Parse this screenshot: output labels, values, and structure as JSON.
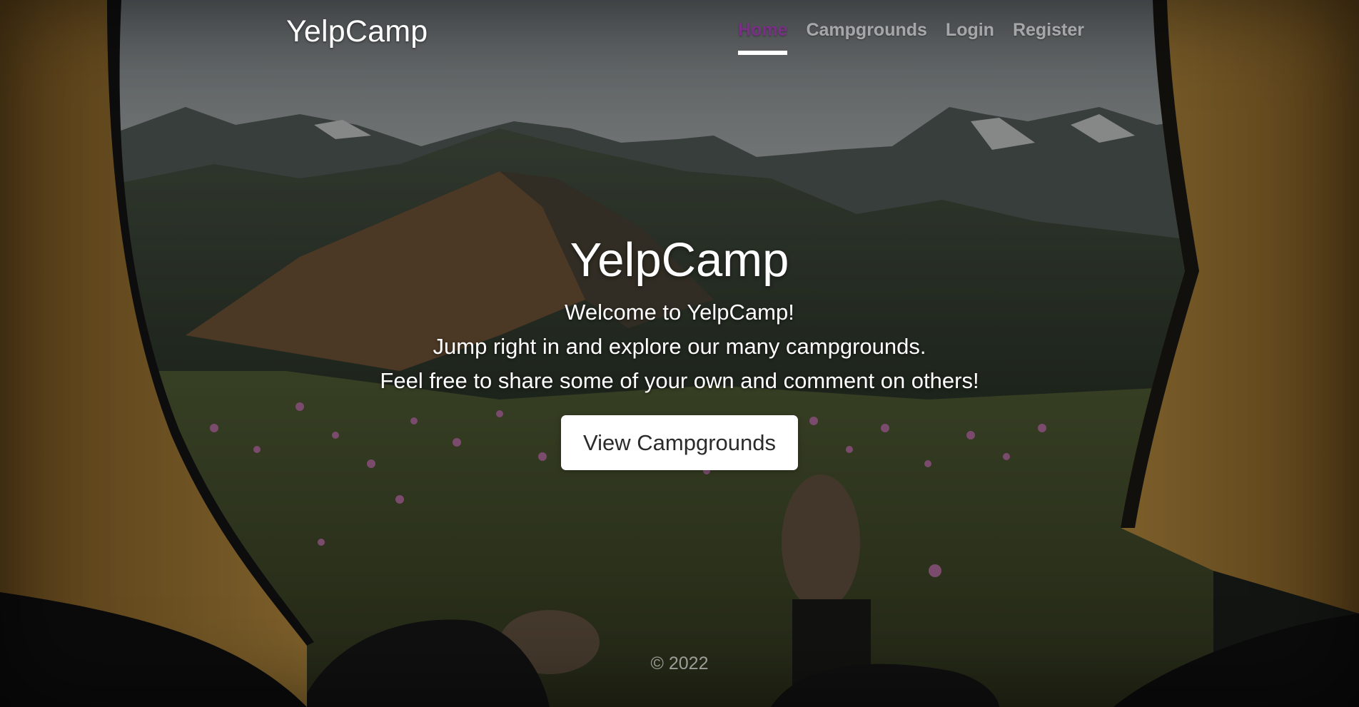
{
  "header": {
    "brand": "YelpCamp",
    "nav": [
      {
        "label": "Home",
        "active": true
      },
      {
        "label": "Campgrounds",
        "active": false
      },
      {
        "label": "Login",
        "active": false
      },
      {
        "label": "Register",
        "active": false
      }
    ]
  },
  "hero": {
    "title": "YelpCamp",
    "lines": [
      "Welcome to YelpCamp!",
      "Jump right in and explore our many campgrounds.",
      "Feel free to share some of your own and comment on others!"
    ],
    "cta_label": "View Campgrounds"
  },
  "footer": {
    "copyright": "© 2022"
  },
  "colors": {
    "active_nav": "#7a2f86",
    "tent_fabric": "#b98a3e",
    "meadow": "#4b5a32",
    "mountains": "#3a4540",
    "sky": "#aeb6b8"
  }
}
